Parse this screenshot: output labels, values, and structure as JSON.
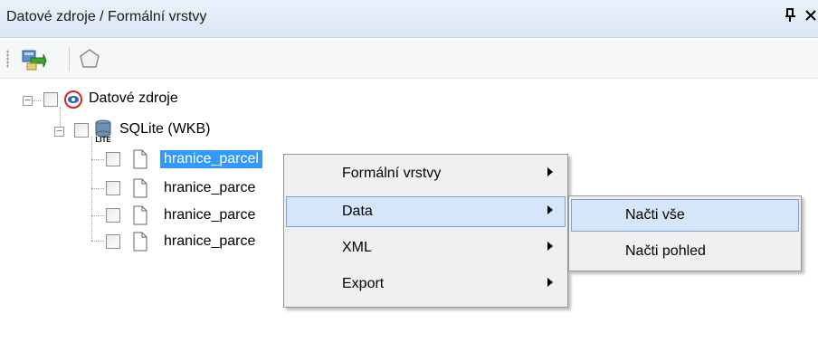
{
  "window": {
    "title": "Datové zdroje / Formální vrstvy",
    "pin_glyph": "ᵖ",
    "close_glyph": "×"
  },
  "toolbar": {
    "buttons": [
      {
        "name": "refresh-sources-icon"
      },
      {
        "name": "polygon-icon"
      }
    ]
  },
  "tree": {
    "root": {
      "label": "Datové zdroje",
      "icon": "datasource-icon",
      "expanded": true
    },
    "source": {
      "label": "SQLite (WKB)",
      "icon": "sqlite-database-icon",
      "icon_text": "LITE",
      "expanded": true
    },
    "layers": [
      {
        "label": "hranice_parcel",
        "selected": true
      },
      {
        "label": "hranice_parce",
        "selected": false
      },
      {
        "label": "hranice_parce",
        "selected": false
      },
      {
        "label": "hranice_parce",
        "selected": false
      }
    ]
  },
  "context_menu": {
    "items": [
      {
        "label": "Formální vrstvy",
        "has_submenu": true,
        "highlighted": false
      },
      {
        "label": "Data",
        "has_submenu": true,
        "highlighted": true
      },
      {
        "label": "XML",
        "has_submenu": true,
        "highlighted": false
      },
      {
        "label": "Export",
        "has_submenu": true,
        "highlighted": false
      }
    ]
  },
  "submenu": {
    "items": [
      {
        "label": "Načti vše",
        "highlighted": true
      },
      {
        "label": "Načti pohled",
        "highlighted": false
      }
    ]
  },
  "colors": {
    "selection": "#3399ff",
    "menu_highlight": "#d5e5fa",
    "menu_highlight_border": "#7da2ce",
    "titlebar": "#dbe6f5"
  }
}
